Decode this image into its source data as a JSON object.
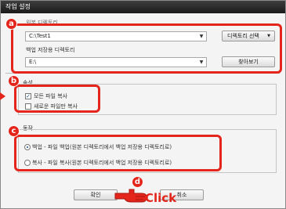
{
  "window": {
    "title": "작업 설정"
  },
  "directory_section": {
    "source_label": "원본 디렉토리",
    "source_value": "C:\\Test1",
    "select_directory_button": "디렉토리 선택",
    "backup_label": "백업 저장용 디렉토리",
    "backup_value": "E:\\",
    "browse_button": "찾아보기"
  },
  "attributes_section": {
    "title": "속성",
    "copy_all_label": "모든 파일 복사",
    "copy_all_checked": true,
    "copy_new_label": "새로운 파일만 복사",
    "copy_new_checked": false
  },
  "mode_section": {
    "title": "동작",
    "option_backup_label": "백업 - 파일 백업(원본 디렉토리에서 백업 저장용 디렉토리로)",
    "option_copy_label": "복사 - 파일 복사(원본 디렉토리에서 백업 저장용 디렉토리로)",
    "selected": "backup"
  },
  "buttons": {
    "ok": "확인",
    "cancel": "취소"
  },
  "annotations": {
    "badge_a": "a",
    "badge_b": "b",
    "badge_c": "c",
    "badge_d": "d",
    "click_text": "Click",
    "highlight_color": "#e4251b"
  }
}
